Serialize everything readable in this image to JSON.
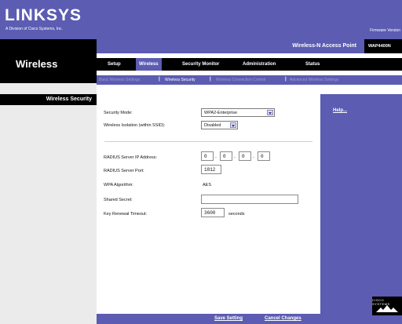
{
  "header": {
    "logo": "LINKSYS",
    "logo_sub": "A Division of Cisco Systems, Inc.",
    "firmware": "Firmware Version"
  },
  "product": {
    "name": "Wireless-N Access Point",
    "model": "WAP4400N"
  },
  "section": {
    "title": "Wireless",
    "sub_title": "Wireless Security"
  },
  "tabs": [
    {
      "label": "Setup"
    },
    {
      "label": "Wireless"
    },
    {
      "label": "Security Monitor"
    },
    {
      "label": "Administration"
    },
    {
      "label": "Status"
    }
  ],
  "subtabs": [
    {
      "label": "Basic Wireless Settings"
    },
    {
      "label": "Wireless Security"
    },
    {
      "label": "Wireless Connection Control"
    },
    {
      "label": "Advanced Wireless Settings"
    }
  ],
  "form": {
    "security_mode_label": "Security Mode:",
    "security_mode_value": "WPA2-Enterprise",
    "isolation_label": "Wireless Isolation (within SSID):",
    "isolation_value": "Disabled",
    "radius_ip_label": "RADIUS Server IP Address:",
    "radius_ip": [
      "0",
      "0",
      "0",
      "0"
    ],
    "radius_port_label": "RADIUS Server Port:",
    "radius_port_value": "1812",
    "wpa_alg_label": "WPA Algorithm:",
    "wpa_alg_value": "AES",
    "shared_secret_label": "Shared Secret:",
    "shared_secret_value": "",
    "key_renewal_label": "Key Renewal Timeout:",
    "key_renewal_value": "3600",
    "key_renewal_unit": "seconds"
  },
  "help": {
    "label": "Help..."
  },
  "buttons": {
    "save": "Save Setting",
    "cancel": "Cancel Changes"
  },
  "cisco": {
    "label": "CISCO SYSTEMS"
  },
  "colors": {
    "brand": "#5b5cb2",
    "black": "#000000",
    "panel": "#ebebeb"
  }
}
